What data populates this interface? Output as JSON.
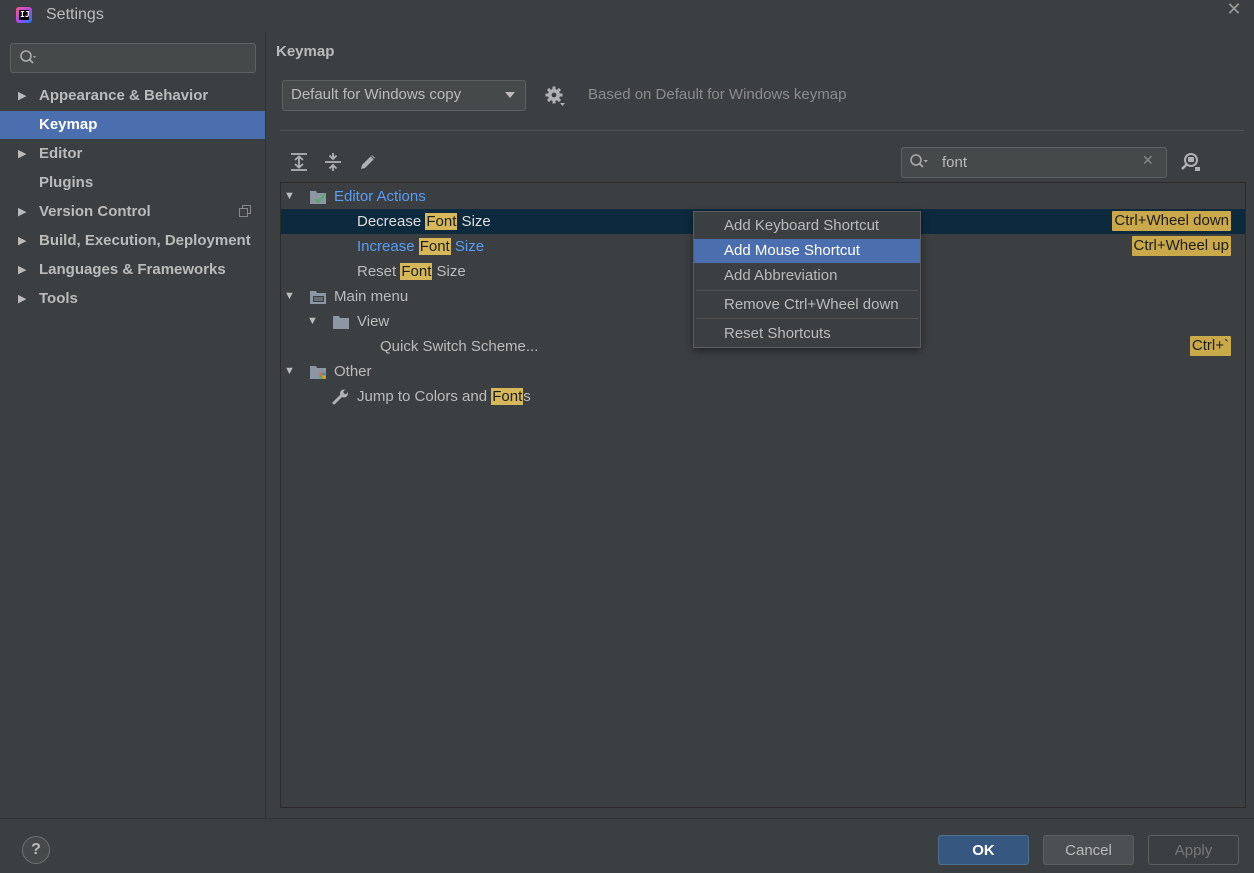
{
  "window": {
    "title": "Settings"
  },
  "sidebar": {
    "search_placeholder": "",
    "items": [
      {
        "label": "Appearance & Behavior",
        "expandable": true
      },
      {
        "label": "Keymap",
        "selected": true
      },
      {
        "label": "Editor",
        "expandable": true
      },
      {
        "label": "Plugins"
      },
      {
        "label": "Version Control",
        "expandable": true
      },
      {
        "label": "Build, Execution, Deployment",
        "expandable": true
      },
      {
        "label": "Languages & Frameworks",
        "expandable": true
      },
      {
        "label": "Tools",
        "expandable": true
      }
    ]
  },
  "keymap": {
    "title": "Keymap",
    "selected_scheme": "Default for Windows copy",
    "based_on": "Based on Default for Windows keymap"
  },
  "tree_search": {
    "value": "font"
  },
  "tree": {
    "editor_actions": "Editor Actions",
    "decrease": {
      "pre": "Decrease ",
      "hl": "Font",
      "post": " Size",
      "shortcut": "Ctrl+Wheel down"
    },
    "increase": {
      "pre": "Increase ",
      "hl": "Font",
      "post": " Size",
      "shortcut": "Ctrl+Wheel up"
    },
    "reset": {
      "pre": "Reset ",
      "hl": "Font",
      "post": " Size"
    },
    "main_menu": "Main menu",
    "view": "View",
    "quick_switch": {
      "label": "Quick Switch Scheme...",
      "shortcut": "Ctrl+`"
    },
    "other": "Other",
    "jump": {
      "pre": "Jump to Colors and ",
      "hl": "Font",
      "post": "s"
    }
  },
  "context_menu": {
    "items": [
      "Add Keyboard Shortcut",
      "Add Mouse Shortcut",
      "Add Abbreviation",
      "Remove Ctrl+Wheel down",
      "Reset Shortcuts"
    ],
    "active_index": 1
  },
  "footer": {
    "help": "?",
    "ok": "OK",
    "cancel": "Cancel",
    "apply": "Apply"
  },
  "colors": {
    "selection": "#4b6eaf",
    "highlight": "#d6b85a",
    "link_blue": "#589df6",
    "background": "#3c3f41"
  }
}
